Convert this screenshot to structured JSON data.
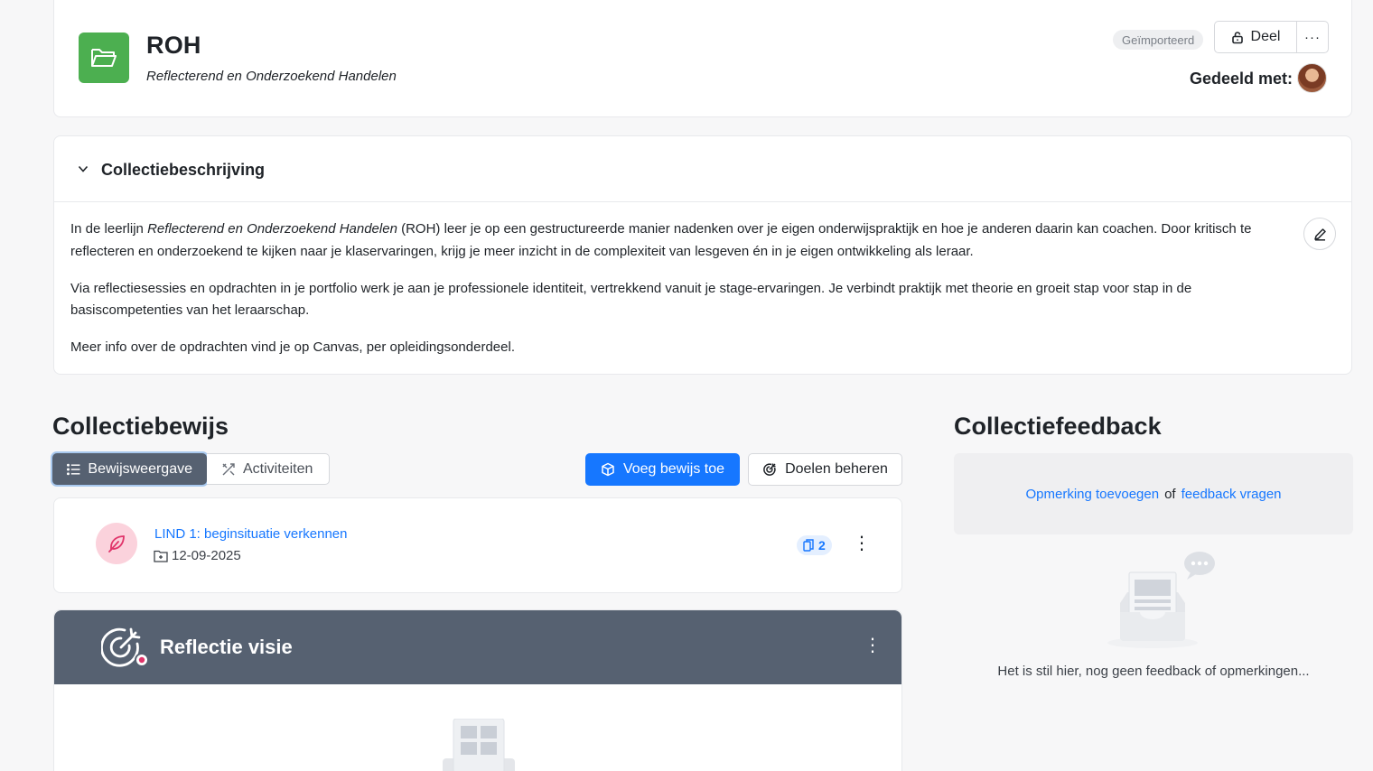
{
  "header": {
    "title": "ROH",
    "subtitle": "Reflecterend en Onderzoekend Handelen",
    "badge": "Geïmporteerd",
    "share_label": "Deel",
    "more_label": "···",
    "shared_with_label": "Gedeeld met:",
    "folder_color": "#4caf50"
  },
  "description": {
    "heading": "Collectiebeschrijving",
    "p1_before": "In de leerlijn ",
    "p1_em": "Reflecterend en Onderzoekend Handelen",
    "p1_after": " (ROH) leer je op een gestructureerde manier nadenken over je eigen onderwijspraktijk en hoe je anderen daarin kan coachen. Door kritisch te reflecteren en onderzoekend te kijken naar je klaservaringen, krijg je meer inzicht in de complexiteit van lesgeven én in je eigen ontwikkeling als leraar.",
    "p2": "Via reflectiesessies en opdrachten in je portfolio werk je aan je professionele identiteit, vertrekkend vanuit je stage-ervaringen. Je verbindt praktijk met theorie en groeit stap voor stap in de basiscompetenties van het leraarschap.",
    "p3": "Meer info over de opdrachten vind je op Canvas, per opleidingsonderdeel."
  },
  "evidence": {
    "heading": "Collectiebewijs",
    "tabs": [
      {
        "label": "Bewijsweergave",
        "active": true
      },
      {
        "label": "Activiteiten",
        "active": false
      }
    ],
    "add_button": "Voeg bewijs toe",
    "goals_button": "Doelen beheren",
    "items": [
      {
        "title": "LIND 1: beginsituatie verkennen",
        "date": "12-09-2025",
        "count": "2",
        "icon": "feather-icon"
      }
    ],
    "goal_card": {
      "title": "Reflectie visie",
      "icon": "target-icon"
    }
  },
  "feedback": {
    "heading": "Collectiefeedback",
    "add_remark": "Opmerking toevoegen",
    "or": "of",
    "ask_feedback": "feedback vragen",
    "empty": "Het is stil hier, nog geen feedback of opmerkingen..."
  },
  "colors": {
    "accent": "#1677ff",
    "slate": "#566171",
    "pink_bg": "#fbd2dc"
  }
}
